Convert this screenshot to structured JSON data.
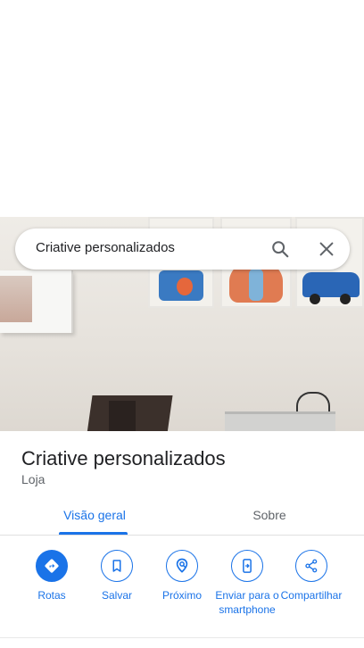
{
  "search": {
    "query": "Criative personalizados"
  },
  "place": {
    "name": "Criative personalizados",
    "category": "Loja"
  },
  "tabs": [
    {
      "label": "Visão geral",
      "active": true
    },
    {
      "label": "Sobre",
      "active": false
    }
  ],
  "actions": [
    {
      "label": "Rotas",
      "icon": "directions-icon"
    },
    {
      "label": "Salvar",
      "icon": "bookmark-icon"
    },
    {
      "label": "Próximo",
      "icon": "nearby-icon"
    },
    {
      "label": "Enviar para o smartphone",
      "icon": "send-to-phone-icon"
    },
    {
      "label": "Compartilhar",
      "icon": "share-icon"
    }
  ],
  "colors": {
    "accent": "#1a73e8",
    "text": "#202124",
    "muted": "#5f6368"
  }
}
